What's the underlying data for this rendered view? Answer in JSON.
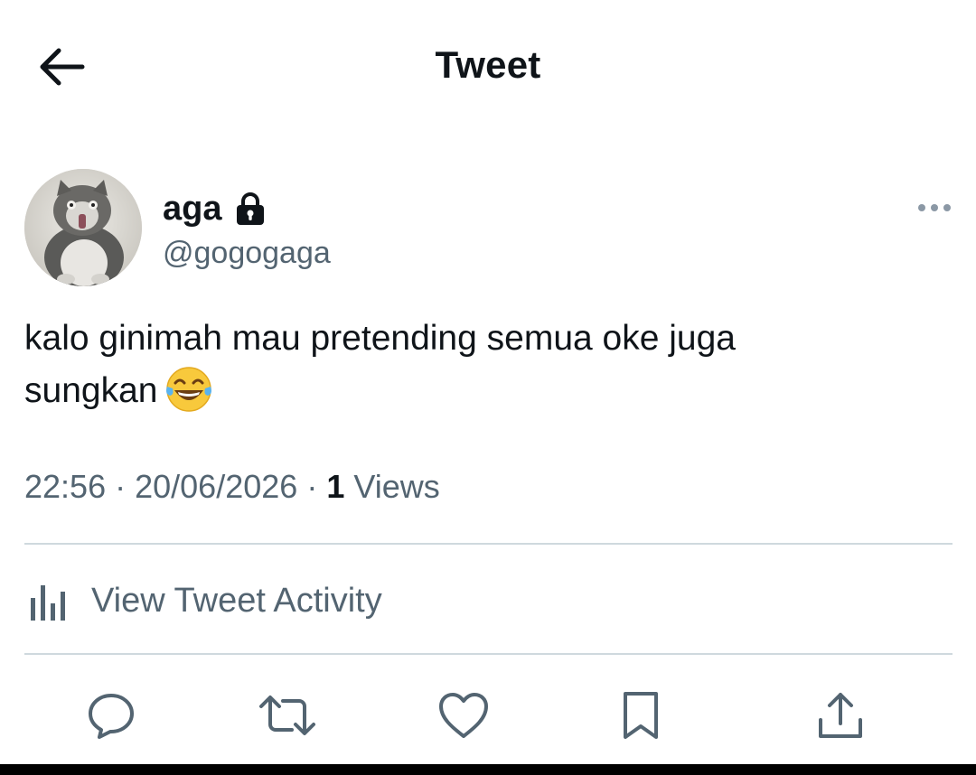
{
  "header": {
    "title": "Tweet",
    "back_icon": "arrow-left-icon"
  },
  "author": {
    "display_name": "aga",
    "handle": "@gogogaga",
    "protected_icon": "lock-icon",
    "avatar": "cat-photo-avatar"
  },
  "tweet": {
    "text_line1": "kalo ginimah mau pretending semua oke juga",
    "text_line2": "sungkan",
    "emoji": "face-with-tears-of-joy",
    "time": "22:56",
    "date": "20/06/2026",
    "views_count": "1",
    "views_label": "Views"
  },
  "activity": {
    "label": "View Tweet Activity",
    "icon": "bar-chart-icon"
  },
  "actions": [
    {
      "name": "reply",
      "icon": "reply-bubble-icon"
    },
    {
      "name": "retweet",
      "icon": "retweet-icon"
    },
    {
      "name": "like",
      "icon": "heart-icon"
    },
    {
      "name": "bookmark",
      "icon": "bookmark-icon"
    },
    {
      "name": "share",
      "icon": "share-icon"
    }
  ],
  "colors": {
    "text_primary": "#0f1419",
    "text_secondary": "#536471",
    "divider": "#cfd9de",
    "background": "#ffffff"
  }
}
